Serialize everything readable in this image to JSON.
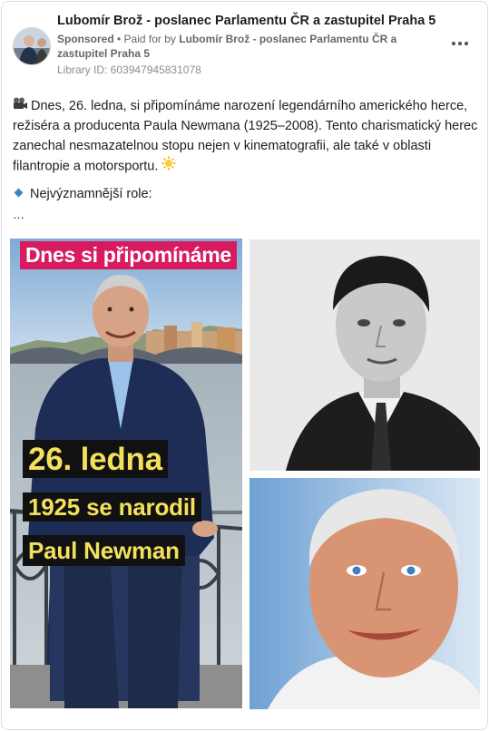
{
  "post": {
    "page_name": "Lubomír Brož - poslanec Parlamentu ČR a zastupitel Praha 5",
    "sponsored_label": "Sponsored",
    "separator": " • ",
    "paid_for_prefix": "Paid for by ",
    "paid_for_name": "Lubomír Brož - poslanec Parlamentu ČR a zastupitel Praha 5",
    "library_id": "Library ID: 603947945831078",
    "more_icon": "more-horizontal-icon"
  },
  "content": {
    "paragraph": "Dnes, 26. ledna, si připomínáme narození legendárního amerického herce, režiséra a producenta Paula Newmana (1925–2008). Tento charismatický herec zanechal nesmazatelnou stopu nejen v kinematografii, ale také v oblasti filantropie a motorsportu.",
    "lead_icon": "film-camera-icon",
    "trail_icon": "sun-icon",
    "roles_icon": "blue-diamond-icon",
    "roles_heading": "Nejvýznamnější role:",
    "see_more": "…"
  },
  "images": {
    "left": {
      "banner": "Dnes si připomínáme",
      "line1": "26. ledna",
      "line2": "1925 se narodil",
      "line3": "Paul Newman",
      "banner_color": "#d81b5f",
      "caption_color": "#f3e15c"
    },
    "top_right": {
      "kind": "black-and-white portrait"
    },
    "bottom_right": {
      "kind": "color portrait"
    }
  }
}
